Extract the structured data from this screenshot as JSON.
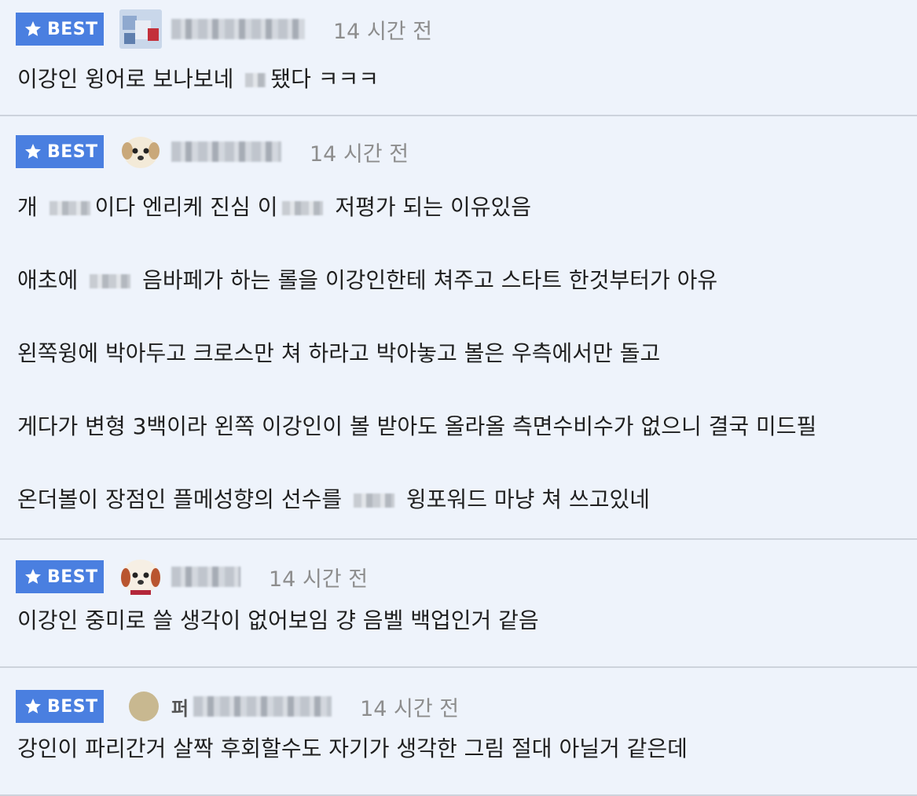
{
  "comments": [
    {
      "badge": "BEST",
      "username": "",
      "time": "14 시간 전",
      "lines": [
        [
          "이강인 윙어로 보나보네 ",
          "됐다 ㅋㅋㅋ"
        ]
      ]
    },
    {
      "badge": "BEST",
      "username": "",
      "time": "14 시간 전",
      "lines": [
        [
          "개 ",
          "이다 엔리케 진심 이",
          " 저평가 되는 이유있음"
        ],
        [
          "애초에 ",
          " 음바페가 하는 롤을 이강인한테 쳐주고 스타트 한것부터가 아유"
        ],
        [
          "왼쪽윙에 박아두고 크로스만 쳐 하라고 박아놓고 볼은 우측에서만 돌고"
        ],
        [
          "게다가 변형 3백이라 왼쪽 이강인이 볼 받아도 올라올 측면수비수가 없으니 결국 미드필"
        ],
        [
          "온더볼이 장점인 플메성향의 선수를 ",
          " 윙포워드 마냥 쳐 쓰고있네"
        ]
      ]
    },
    {
      "badge": "BEST",
      "username": "",
      "time": "14 시간 전",
      "lines": [
        [
          "이강인 중미로 쓸 생각이 없어보임 걍 음벨 백업인거 같음"
        ]
      ]
    },
    {
      "badge": "BEST",
      "username": "퍼",
      "time": "14 시간 전",
      "lines": [
        [
          "강인이 파리간거 살짝 후회할수도 자기가 생각한 그림 절대 아닐거 같은데"
        ]
      ]
    }
  ]
}
